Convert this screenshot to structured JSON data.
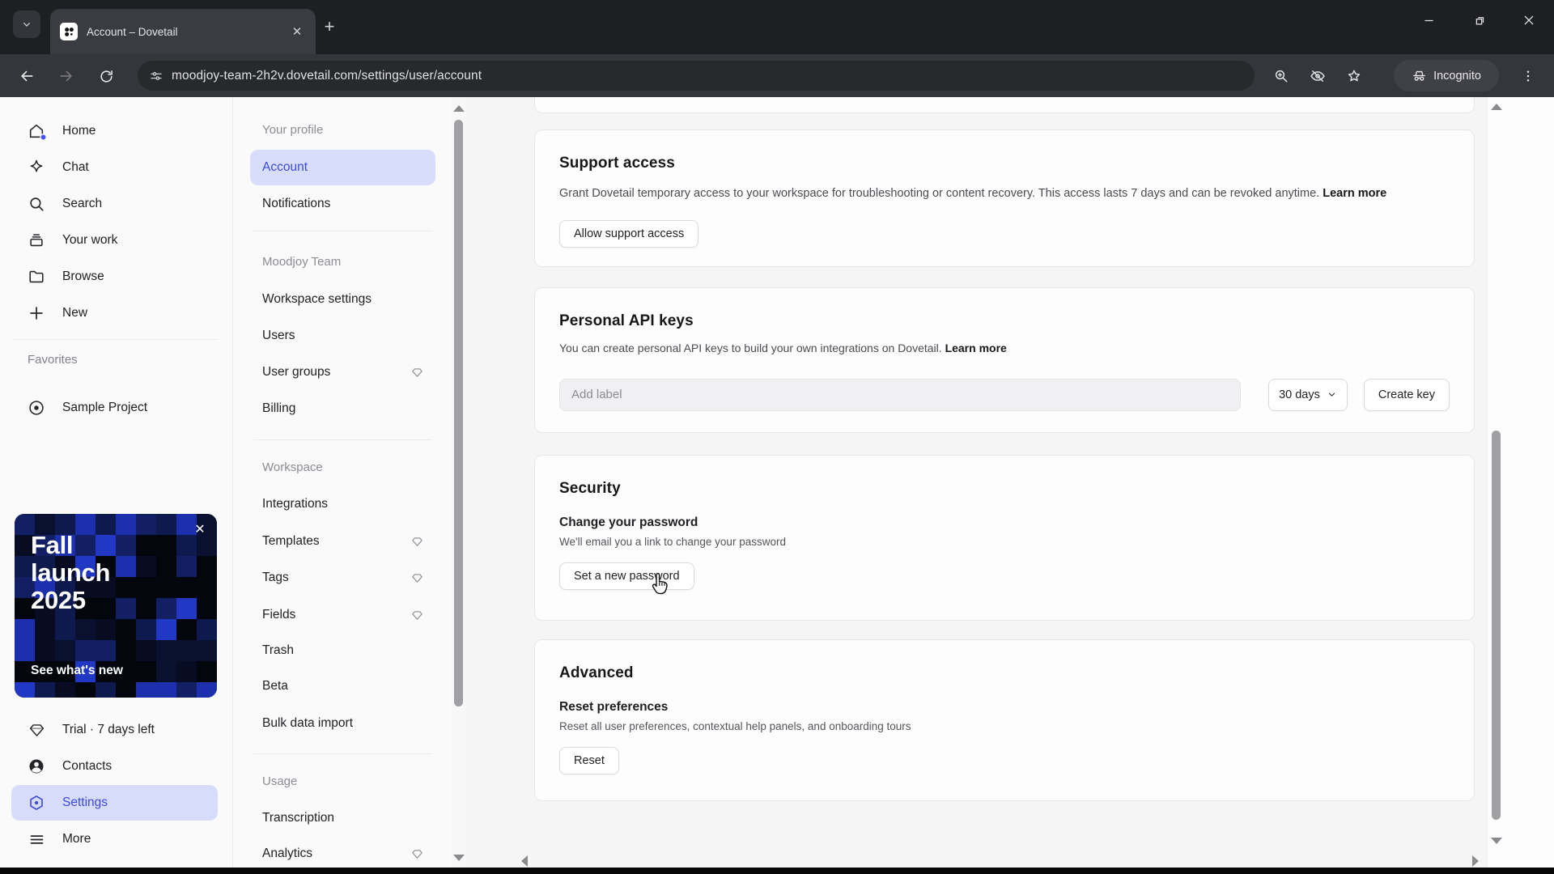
{
  "browser": {
    "tab": {
      "title": "Account – Dovetail"
    },
    "address": {
      "url": "moodjoy-team-2h2v.dovetail.com/settings/user/account"
    },
    "incognito_label": "Incognito"
  },
  "sidebar": {
    "nav": [
      {
        "label": "Home",
        "icon": "home-icon"
      },
      {
        "label": "Chat",
        "icon": "sparkle-icon"
      },
      {
        "label": "Search",
        "icon": "search-icon"
      },
      {
        "label": "Your work",
        "icon": "inbox-icon"
      },
      {
        "label": "Browse",
        "icon": "folder-icon"
      },
      {
        "label": "New",
        "icon": "plus-icon"
      }
    ],
    "favorites_header": "Favorites",
    "favorites": [
      {
        "label": "Sample Project",
        "icon": "target-icon"
      }
    ],
    "banner": {
      "line1": "Fall",
      "line2": "launch",
      "line3": "2025",
      "cta": "See what's new",
      "close": "✕"
    },
    "footer": [
      {
        "label": "Trial · 7 days left",
        "icon": "gem-icon"
      },
      {
        "label": "Contacts",
        "icon": "contact-icon"
      },
      {
        "label": "Settings",
        "icon": "settings-icon",
        "selected": true
      },
      {
        "label": "More",
        "icon": "menu-icon"
      }
    ]
  },
  "settings_nav": {
    "sections": [
      {
        "header": "Your profile",
        "items": [
          {
            "label": "Account",
            "selected": true
          },
          {
            "label": "Notifications"
          }
        ]
      },
      {
        "header": "Moodjoy Team",
        "items": [
          {
            "label": "Workspace settings"
          },
          {
            "label": "Users"
          },
          {
            "label": "User groups",
            "gem": true
          },
          {
            "label": "Billing"
          }
        ]
      },
      {
        "header": "Workspace",
        "items": [
          {
            "label": "Integrations"
          },
          {
            "label": "Templates",
            "gem": true
          },
          {
            "label": "Tags",
            "gem": true
          },
          {
            "label": "Fields",
            "gem": true
          },
          {
            "label": "Trash"
          },
          {
            "label": "Beta"
          },
          {
            "label": "Bulk data import"
          }
        ]
      },
      {
        "header": "Usage",
        "items": [
          {
            "label": "Transcription"
          },
          {
            "label": "Analytics",
            "gem": true
          }
        ]
      }
    ]
  },
  "main": {
    "support": {
      "title": "Support access",
      "description": "Grant Dovetail temporary access to your workspace for troubleshooting or content recovery. This access lasts 7 days and can be revoked anytime.",
      "link": "Learn more",
      "button": "Allow support access"
    },
    "api": {
      "title": "Personal API keys",
      "description": "You can create personal API keys to build your own integrations on Dovetail.",
      "link": "Learn more",
      "input_placeholder": "Add label",
      "expiry_value": "30 days",
      "button": "Create key"
    },
    "security": {
      "title": "Security",
      "subtitle": "Change your password",
      "description": "We'll email you a link to change your password",
      "button": "Set a new password"
    },
    "advanced": {
      "title": "Advanced",
      "subtitle": "Reset preferences",
      "description": "Reset all user preferences, contextual help panels, and onboarding tours",
      "button": "Reset"
    }
  },
  "colors": {
    "accent_blue": "#3b49df",
    "selected_bg": "#d8ddfb",
    "banner_blue": "#1c30ae",
    "chrome_dark": "#1e1f23"
  }
}
